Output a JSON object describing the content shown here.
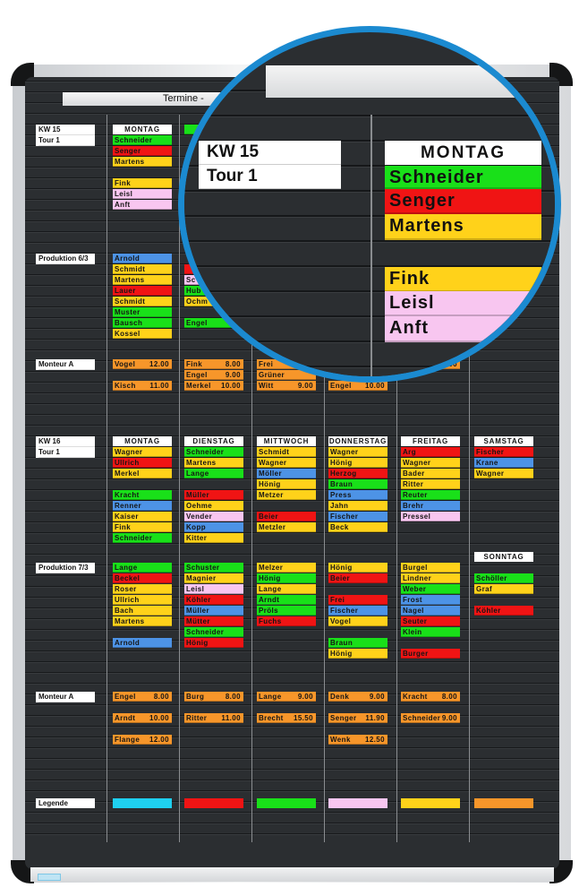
{
  "board": {
    "title": "Termine -"
  },
  "colors": {
    "g": "#19e019",
    "r": "#f01414",
    "y": "#ffd21a",
    "b": "#4d93e6",
    "p": "#f8c6f0",
    "o": "#f7962a",
    "c": "#1fd0f0",
    "ring": "#1b8ad0"
  },
  "groups": [
    {
      "labels": [
        "KW 15",
        "Tour 1"
      ],
      "cols": [
        {
          "header": "MONTAG",
          "cards": [
            {
              "name": "Schneider",
              "color": "g"
            },
            {
              "name": "Senger",
              "color": "r"
            },
            {
              "name": "Martens",
              "color": "y"
            },
            null,
            {
              "name": "Fink",
              "color": "y"
            },
            {
              "name": "Leisl",
              "color": "p"
            },
            {
              "name": "Anft",
              "color": "p"
            }
          ]
        },
        {
          "cards": [
            {
              "name": "",
              "color": "g"
            }
          ]
        },
        {
          "cards": []
        },
        {
          "cards": []
        },
        {
          "cards": []
        },
        {
          "cards": [
            {
              "name": "",
              "color": "r"
            },
            {
              "name": "",
              "color": "g"
            },
            {
              "name": "",
              "color": "y"
            }
          ]
        }
      ]
    },
    {
      "labels": [
        "Produktion 6/3"
      ],
      "cols": [
        {
          "cards": [
            {
              "name": "Arnold",
              "color": "b"
            },
            {
              "name": "Schmidt",
              "color": "y"
            },
            {
              "name": "Martens",
              "color": "y"
            },
            {
              "name": "Lauer",
              "color": "r"
            },
            {
              "name": "Schmidt",
              "color": "y"
            },
            {
              "name": "Muster",
              "color": "g"
            },
            {
              "name": "Bausch",
              "color": "g"
            },
            {
              "name": "Kossel",
              "color": "y"
            }
          ]
        },
        {
          "cards": [
            null,
            {
              "name": "",
              "color": "r"
            },
            {
              "name": "Sc",
              "color": "p"
            },
            {
              "name": "Hub",
              "color": "g"
            },
            {
              "name": "Ochm",
              "color": "y"
            },
            null,
            {
              "name": "Engel",
              "color": "g"
            }
          ]
        },
        {
          "cards": []
        },
        {
          "cards": []
        },
        {
          "cards": []
        },
        {
          "cards": []
        }
      ]
    },
    {
      "labels": [
        "Monteur A"
      ],
      "cols": [
        {
          "cards": [
            {
              "name": "Vogel",
              "hours": "12.00",
              "color": "o"
            },
            null,
            {
              "name": "Kisch",
              "hours": "11.00",
              "color": "o"
            }
          ]
        },
        {
          "cards": [
            {
              "name": "Fink",
              "hours": "8.00",
              "color": "o"
            },
            {
              "name": "Engel",
              "hours": "9.00",
              "color": "o"
            },
            {
              "name": "Merkel",
              "hours": "10.00",
              "color": "o"
            }
          ]
        },
        {
          "cards": [
            {
              "name": "Frei",
              "color": "o"
            },
            {
              "name": "Grüner",
              "color": "o"
            },
            {
              "name": "Witt",
              "hours": "9.00",
              "color": "o"
            }
          ]
        },
        {
          "cards": [
            null,
            null,
            {
              "name": "Engel",
              "hours": "10.00",
              "color": "o"
            }
          ]
        },
        {
          "cards": [
            {
              "name": "",
              "hours": "8.00",
              "color": "o"
            }
          ]
        },
        {
          "cards": []
        }
      ]
    },
    {
      "labels": [
        "KW 16",
        "Tour 1"
      ],
      "cols": [
        {
          "header": "MONTAG",
          "cards": [
            {
              "name": "Wagner",
              "color": "y"
            },
            {
              "name": "Ullrich",
              "color": "r"
            },
            {
              "name": "Merkel",
              "color": "y"
            },
            null,
            {
              "name": "Kracht",
              "color": "g"
            },
            {
              "name": "Renner",
              "color": "b"
            },
            {
              "name": "Kaiser",
              "color": "y"
            },
            {
              "name": "Fink",
              "color": "y"
            },
            {
              "name": "Schneider",
              "color": "g"
            }
          ]
        },
        {
          "header": "DIENSTAG",
          "cards": [
            {
              "name": "Schneider",
              "color": "g"
            },
            {
              "name": "Martens",
              "color": "y"
            },
            {
              "name": "Lange",
              "color": "g"
            },
            null,
            {
              "name": "Müller",
              "color": "r"
            },
            {
              "name": "Oehme",
              "color": "y"
            },
            {
              "name": "Vender",
              "color": "p"
            },
            {
              "name": "Kopp",
              "color": "b"
            },
            {
              "name": "Kitter",
              "color": "y"
            }
          ]
        },
        {
          "header": "MITTWOCH",
          "cards": [
            {
              "name": "Schmidt",
              "color": "y"
            },
            {
              "name": "Wagner",
              "color": "y"
            },
            {
              "name": "Möller",
              "color": "b"
            },
            {
              "name": "Hönig",
              "color": "y"
            },
            {
              "name": "Metzer",
              "color": "y"
            },
            null,
            {
              "name": "Beier",
              "color": "r"
            },
            {
              "name": "Metzler",
              "color": "y"
            }
          ]
        },
        {
          "header": "DONNERSTAG",
          "cards": [
            {
              "name": "Wagner",
              "color": "y"
            },
            {
              "name": "Hönig",
              "color": "y"
            },
            {
              "name": "Herzog",
              "color": "r"
            },
            {
              "name": "Braun",
              "color": "g"
            },
            {
              "name": "Press",
              "color": "b"
            },
            {
              "name": "Jahn",
              "color": "y"
            },
            {
              "name": "Fischer",
              "color": "b"
            },
            {
              "name": "Beck",
              "color": "y"
            }
          ]
        },
        {
          "header": "FREITAG",
          "cards": [
            {
              "name": "Arg",
              "color": "r"
            },
            {
              "name": "Wagner",
              "color": "y"
            },
            {
              "name": "Bader",
              "color": "y"
            },
            {
              "name": "Ritter",
              "color": "y"
            },
            {
              "name": "Reuter",
              "color": "g"
            },
            {
              "name": "Brehr",
              "color": "b"
            },
            {
              "name": "Pressel",
              "color": "p"
            }
          ]
        },
        {
          "header": "SAMSTAG",
          "cards": [
            {
              "name": "Fischer",
              "color": "r"
            },
            {
              "name": "Krane",
              "color": "b"
            },
            {
              "name": "Wagner",
              "color": "y"
            }
          ]
        }
      ]
    },
    {
      "labels": [
        "Produktion 7/3"
      ],
      "cols": [
        {
          "cards": [
            {
              "name": "Lange",
              "color": "g"
            },
            {
              "name": "Beckel",
              "color": "r"
            },
            {
              "name": "Roser",
              "color": "y"
            },
            {
              "name": "Ullrich",
              "color": "y"
            },
            {
              "name": "Bach",
              "color": "y"
            },
            {
              "name": "Martens",
              "color": "y"
            },
            null,
            {
              "name": "Arnold",
              "color": "b"
            }
          ]
        },
        {
          "cards": [
            {
              "name": "Schuster",
              "color": "g"
            },
            {
              "name": "Magnier",
              "color": "y"
            },
            {
              "name": "Leisl",
              "color": "p"
            },
            {
              "name": "Köhler",
              "color": "r"
            },
            {
              "name": "Müller",
              "color": "b"
            },
            {
              "name": "Mütter",
              "color": "r"
            },
            {
              "name": "Schneider",
              "color": "g"
            },
            {
              "name": "Hönig",
              "color": "r"
            }
          ]
        },
        {
          "cards": [
            {
              "name": "Melzer",
              "color": "y"
            },
            {
              "name": "Hönig",
              "color": "g"
            },
            {
              "name": "Lange",
              "color": "y"
            },
            {
              "name": "Arndt",
              "color": "g"
            },
            {
              "name": "Pröls",
              "color": "g"
            },
            {
              "name": "Fuchs",
              "color": "r"
            }
          ]
        },
        {
          "cards": [
            {
              "name": "Hönig",
              "color": "y"
            },
            {
              "name": "Beier",
              "color": "r"
            },
            null,
            {
              "name": "Frei",
              "color": "r"
            },
            {
              "name": "Fischer",
              "color": "b"
            },
            {
              "name": "Vogel",
              "color": "y"
            },
            null,
            {
              "name": "Braun",
              "color": "g"
            },
            {
              "name": "Hönig",
              "color": "y"
            }
          ]
        },
        {
          "cards": [
            {
              "name": "Burgel",
              "color": "y"
            },
            {
              "name": "Lindner",
              "color": "y"
            },
            {
              "name": "Weber",
              "color": "g"
            },
            {
              "name": "Frost",
              "color": "b"
            },
            {
              "name": "Nagel",
              "color": "b"
            },
            {
              "name": "Seuter",
              "color": "r"
            },
            {
              "name": "Klein",
              "color": "g"
            },
            null,
            {
              "name": "Burger",
              "color": "r"
            }
          ]
        },
        {
          "header": "SONNTAG",
          "cards": [
            null,
            {
              "name": "Schöller",
              "color": "g"
            },
            {
              "name": "Graf",
              "color": "y"
            },
            null,
            {
              "name": "Köhler",
              "color": "r"
            }
          ]
        }
      ]
    },
    {
      "labels": [
        "Monteur A"
      ],
      "cols": [
        {
          "cards": [
            {
              "name": "Engel",
              "hours": "8.00",
              "color": "o"
            },
            null,
            {
              "name": "Arndt",
              "hours": "10.00",
              "color": "o"
            },
            null,
            {
              "name": "Flange",
              "hours": "12.00",
              "color": "o"
            }
          ]
        },
        {
          "cards": [
            {
              "name": "Burg",
              "hours": "8.00",
              "color": "o"
            },
            null,
            {
              "name": "Ritter",
              "hours": "11.00",
              "color": "o"
            }
          ]
        },
        {
          "cards": [
            {
              "name": "Lange",
              "hours": "9.00",
              "color": "o"
            },
            null,
            {
              "name": "Brecht",
              "hours": "15.50",
              "color": "o"
            }
          ]
        },
        {
          "cards": [
            {
              "name": "Denk",
              "hours": "9.00",
              "color": "o"
            },
            null,
            {
              "name": "Senger",
              "hours": "11.90",
              "color": "o"
            },
            null,
            {
              "name": "Wenk",
              "hours": "12.50",
              "color": "o"
            }
          ]
        },
        {
          "cards": [
            {
              "name": "Kracht",
              "hours": "8.00",
              "color": "o"
            },
            null,
            {
              "name": "Schneider",
              "hours": "9.00",
              "color": "o"
            }
          ]
        },
        {
          "cards": []
        }
      ]
    }
  ],
  "legend": {
    "label": "Legende",
    "swatches": [
      "c",
      "r",
      "g",
      "p",
      "y",
      "o"
    ]
  }
}
